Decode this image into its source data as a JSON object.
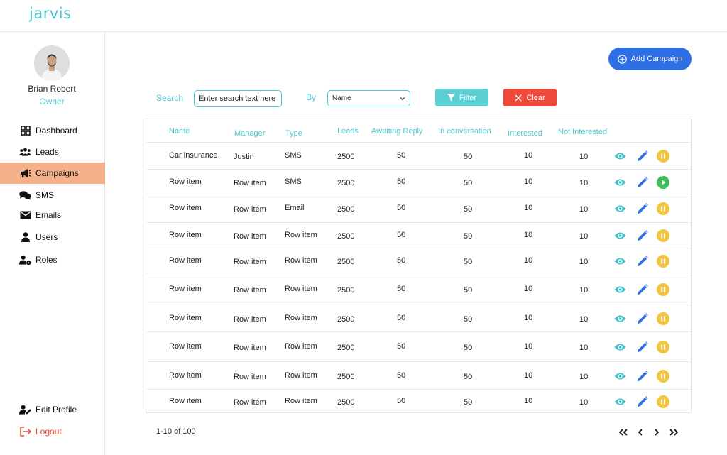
{
  "app": {
    "brand": "jarvis"
  },
  "user": {
    "name": "Brian Robert",
    "role": "Owner"
  },
  "sidebar": {
    "items": [
      {
        "label": "Dashboard",
        "icon": "dashboard-icon"
      },
      {
        "label": "Leads",
        "icon": "users-group-icon"
      },
      {
        "label": "Campaigns",
        "icon": "megaphone-icon",
        "active": true
      },
      {
        "label": "SMS",
        "icon": "chat-icon"
      },
      {
        "label": "Emails",
        "icon": "mail-icon"
      },
      {
        "label": "Users",
        "icon": "user-icon"
      },
      {
        "label": "Roles",
        "icon": "user-cog-icon"
      }
    ],
    "bottom": [
      {
        "label": "Edit Profile",
        "icon": "user-edit-icon"
      },
      {
        "label": "Logout",
        "icon": "logout-icon"
      }
    ]
  },
  "toolbar": {
    "add_label": "Add Campaign",
    "search_label": "Search",
    "search_placeholder": "Enter search text here",
    "by_label": "By",
    "by_selected": "Name",
    "filter_label": "Filter",
    "clear_label": "Clear"
  },
  "table": {
    "columns": [
      "Name",
      "Manager",
      "Type",
      "Leads",
      "Awaiting Reply",
      "In conversation",
      "Interested",
      "Not Interested"
    ],
    "rows": [
      {
        "name": "Car insurance",
        "manager": "Justin",
        "type": "SMS",
        "leads": "2500",
        "awaiting": "50",
        "conversation": "50",
        "interested": "10",
        "not_interested": "10",
        "status": "pause"
      },
      {
        "name": "Row item",
        "manager": "Row item",
        "type": "SMS",
        "leads": "2500",
        "awaiting": "50",
        "conversation": "50",
        "interested": "10",
        "not_interested": "10",
        "status": "play"
      },
      {
        "name": "Row item",
        "manager": "Row item",
        "type": "Email",
        "leads": "2500",
        "awaiting": "50",
        "conversation": "50",
        "interested": "10",
        "not_interested": "10",
        "status": "pause"
      },
      {
        "name": "Row item",
        "manager": "Row item",
        "type": "Row item",
        "leads": "2500",
        "awaiting": "50",
        "conversation": "50",
        "interested": "10",
        "not_interested": "10",
        "status": "pause"
      },
      {
        "name": "Row item",
        "manager": "Row item",
        "type": "Row item",
        "leads": "2500",
        "awaiting": "50",
        "conversation": "50",
        "interested": "10",
        "not_interested": "10",
        "status": "pause"
      },
      {
        "name": "Row item",
        "manager": "Row item",
        "type": "Row item",
        "leads": "2500",
        "awaiting": "50",
        "conversation": "50",
        "interested": "10",
        "not_interested": "10",
        "status": "pause"
      },
      {
        "name": "Row item",
        "manager": "Row item",
        "type": "Row item",
        "leads": "2500",
        "awaiting": "50",
        "conversation": "50",
        "interested": "10",
        "not_interested": "10",
        "status": "pause"
      },
      {
        "name": "Row item",
        "manager": "Row item",
        "type": "Row item",
        "leads": "2500",
        "awaiting": "50",
        "conversation": "50",
        "interested": "10",
        "not_interested": "10",
        "status": "pause"
      },
      {
        "name": "Row item",
        "manager": "Row item",
        "type": "Row item",
        "leads": "2500",
        "awaiting": "50",
        "conversation": "50",
        "interested": "10",
        "not_interested": "10",
        "status": "pause"
      },
      {
        "name": "Row item",
        "manager": "Row item",
        "type": "Row item",
        "leads": "2500",
        "awaiting": "50",
        "conversation": "50",
        "interested": "10",
        "not_interested": "10",
        "status": "pause"
      }
    ]
  },
  "pagination": {
    "text": "1-10 of 100"
  },
  "colors": {
    "accent": "#4ec8cf",
    "primary": "#2f6fe6",
    "danger": "#ee4a3c",
    "active_nav": "#f4b18a",
    "pause": "#f2c53d",
    "play": "#3cbf5a"
  }
}
